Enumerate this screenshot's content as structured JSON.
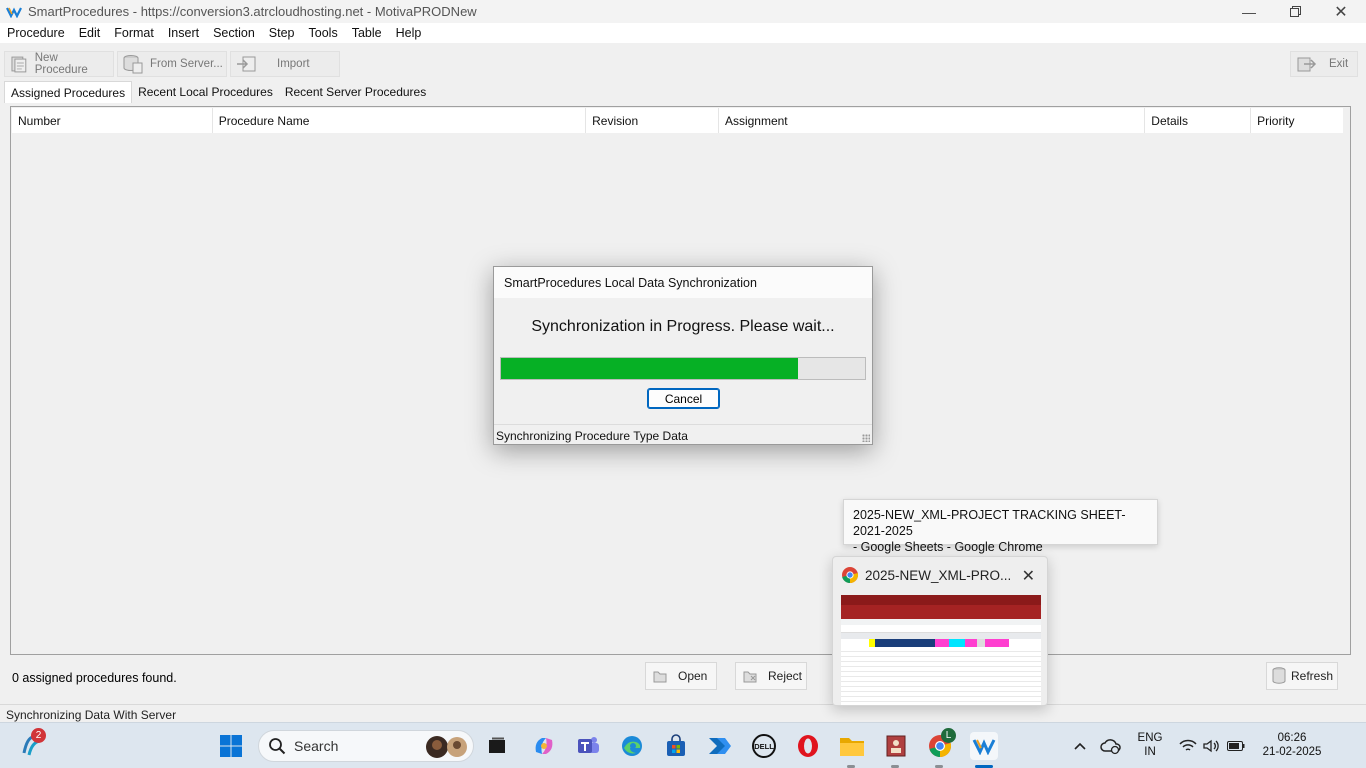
{
  "window": {
    "title": "SmartProcedures - https://conversion3.atrcloudhosting.net - MotivaPRODNew"
  },
  "menu": [
    "Procedure",
    "Edit",
    "Format",
    "Insert",
    "Section",
    "Step",
    "Tools",
    "Table",
    "Help"
  ],
  "toolbar": {
    "new_procedure": "New Procedure",
    "from_server": "From Server...",
    "import": "Import",
    "exit": "Exit"
  },
  "tabs": [
    "Assigned Procedures",
    "Recent Local Procedures",
    "Recent Server Procedures"
  ],
  "grid": {
    "columns": [
      "Number",
      "Procedure Name",
      "Revision",
      "Assignment",
      "Details",
      "Priority"
    ]
  },
  "footer": {
    "count_text": "0 assigned procedures found.",
    "open": "Open",
    "reject": "Reject",
    "refresh": "Refresh",
    "status": "Synchronizing Data With Server"
  },
  "dialog": {
    "title": "SmartProcedures Local Data Synchronization",
    "message": "Synchronization in Progress.  Please wait...",
    "progress_fraction": 0.815,
    "cancel": "Cancel",
    "status": "Synchronizing Procedure Type Data",
    "progress_color": "#06b025"
  },
  "taskbar_preview": {
    "tooltip_line1": "2025-NEW_XML-PROJECT TRACKING SHEET-2021-2025",
    "tooltip_line2": "- Google Sheets - Google Chrome",
    "window_title": "2025-NEW_XML-PRO..."
  },
  "taskbar": {
    "search_label": "Search",
    "notification_count": "2",
    "chrome_profile": "L",
    "language_line1": "ENG",
    "language_line2": "IN",
    "time": "06:26",
    "date": "21-02-2025"
  }
}
